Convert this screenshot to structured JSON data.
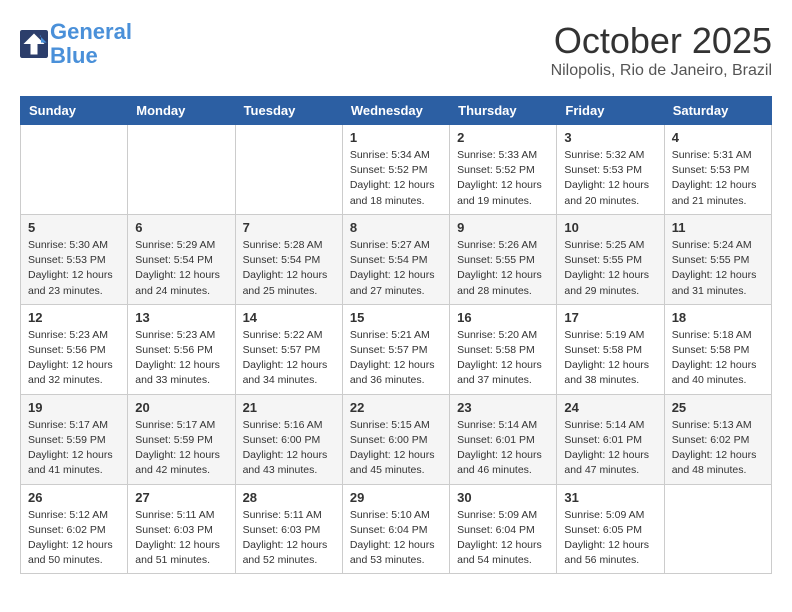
{
  "logo": {
    "line1": "General",
    "line2": "Blue"
  },
  "title": "October 2025",
  "subtitle": "Nilopolis, Rio de Janeiro, Brazil",
  "days_of_week": [
    "Sunday",
    "Monday",
    "Tuesday",
    "Wednesday",
    "Thursday",
    "Friday",
    "Saturday"
  ],
  "weeks": [
    [
      {
        "day": "",
        "info": ""
      },
      {
        "day": "",
        "info": ""
      },
      {
        "day": "",
        "info": ""
      },
      {
        "day": "1",
        "info": "Sunrise: 5:34 AM\nSunset: 5:52 PM\nDaylight: 12 hours\nand 18 minutes."
      },
      {
        "day": "2",
        "info": "Sunrise: 5:33 AM\nSunset: 5:52 PM\nDaylight: 12 hours\nand 19 minutes."
      },
      {
        "day": "3",
        "info": "Sunrise: 5:32 AM\nSunset: 5:53 PM\nDaylight: 12 hours\nand 20 minutes."
      },
      {
        "day": "4",
        "info": "Sunrise: 5:31 AM\nSunset: 5:53 PM\nDaylight: 12 hours\nand 21 minutes."
      }
    ],
    [
      {
        "day": "5",
        "info": "Sunrise: 5:30 AM\nSunset: 5:53 PM\nDaylight: 12 hours\nand 23 minutes."
      },
      {
        "day": "6",
        "info": "Sunrise: 5:29 AM\nSunset: 5:54 PM\nDaylight: 12 hours\nand 24 minutes."
      },
      {
        "day": "7",
        "info": "Sunrise: 5:28 AM\nSunset: 5:54 PM\nDaylight: 12 hours\nand 25 minutes."
      },
      {
        "day": "8",
        "info": "Sunrise: 5:27 AM\nSunset: 5:54 PM\nDaylight: 12 hours\nand 27 minutes."
      },
      {
        "day": "9",
        "info": "Sunrise: 5:26 AM\nSunset: 5:55 PM\nDaylight: 12 hours\nand 28 minutes."
      },
      {
        "day": "10",
        "info": "Sunrise: 5:25 AM\nSunset: 5:55 PM\nDaylight: 12 hours\nand 29 minutes."
      },
      {
        "day": "11",
        "info": "Sunrise: 5:24 AM\nSunset: 5:55 PM\nDaylight: 12 hours\nand 31 minutes."
      }
    ],
    [
      {
        "day": "12",
        "info": "Sunrise: 5:23 AM\nSunset: 5:56 PM\nDaylight: 12 hours\nand 32 minutes."
      },
      {
        "day": "13",
        "info": "Sunrise: 5:23 AM\nSunset: 5:56 PM\nDaylight: 12 hours\nand 33 minutes."
      },
      {
        "day": "14",
        "info": "Sunrise: 5:22 AM\nSunset: 5:57 PM\nDaylight: 12 hours\nand 34 minutes."
      },
      {
        "day": "15",
        "info": "Sunrise: 5:21 AM\nSunset: 5:57 PM\nDaylight: 12 hours\nand 36 minutes."
      },
      {
        "day": "16",
        "info": "Sunrise: 5:20 AM\nSunset: 5:58 PM\nDaylight: 12 hours\nand 37 minutes."
      },
      {
        "day": "17",
        "info": "Sunrise: 5:19 AM\nSunset: 5:58 PM\nDaylight: 12 hours\nand 38 minutes."
      },
      {
        "day": "18",
        "info": "Sunrise: 5:18 AM\nSunset: 5:58 PM\nDaylight: 12 hours\nand 40 minutes."
      }
    ],
    [
      {
        "day": "19",
        "info": "Sunrise: 5:17 AM\nSunset: 5:59 PM\nDaylight: 12 hours\nand 41 minutes."
      },
      {
        "day": "20",
        "info": "Sunrise: 5:17 AM\nSunset: 5:59 PM\nDaylight: 12 hours\nand 42 minutes."
      },
      {
        "day": "21",
        "info": "Sunrise: 5:16 AM\nSunset: 6:00 PM\nDaylight: 12 hours\nand 43 minutes."
      },
      {
        "day": "22",
        "info": "Sunrise: 5:15 AM\nSunset: 6:00 PM\nDaylight: 12 hours\nand 45 minutes."
      },
      {
        "day": "23",
        "info": "Sunrise: 5:14 AM\nSunset: 6:01 PM\nDaylight: 12 hours\nand 46 minutes."
      },
      {
        "day": "24",
        "info": "Sunrise: 5:14 AM\nSunset: 6:01 PM\nDaylight: 12 hours\nand 47 minutes."
      },
      {
        "day": "25",
        "info": "Sunrise: 5:13 AM\nSunset: 6:02 PM\nDaylight: 12 hours\nand 48 minutes."
      }
    ],
    [
      {
        "day": "26",
        "info": "Sunrise: 5:12 AM\nSunset: 6:02 PM\nDaylight: 12 hours\nand 50 minutes."
      },
      {
        "day": "27",
        "info": "Sunrise: 5:11 AM\nSunset: 6:03 PM\nDaylight: 12 hours\nand 51 minutes."
      },
      {
        "day": "28",
        "info": "Sunrise: 5:11 AM\nSunset: 6:03 PM\nDaylight: 12 hours\nand 52 minutes."
      },
      {
        "day": "29",
        "info": "Sunrise: 5:10 AM\nSunset: 6:04 PM\nDaylight: 12 hours\nand 53 minutes."
      },
      {
        "day": "30",
        "info": "Sunrise: 5:09 AM\nSunset: 6:04 PM\nDaylight: 12 hours\nand 54 minutes."
      },
      {
        "day": "31",
        "info": "Sunrise: 5:09 AM\nSunset: 6:05 PM\nDaylight: 12 hours\nand 56 minutes."
      },
      {
        "day": "",
        "info": ""
      }
    ]
  ]
}
